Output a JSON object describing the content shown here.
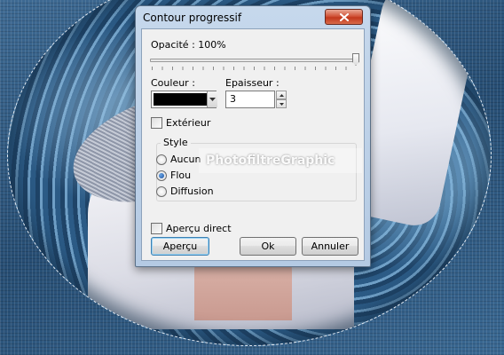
{
  "dialog": {
    "title": "Contour progressif",
    "close_icon": "close-icon",
    "opacity": {
      "label": "Opacité : 100%",
      "value_percent": 100
    },
    "color": {
      "label": "Couleur :",
      "value": "#000000",
      "dropdown_icon": "chevron-down-icon"
    },
    "thickness": {
      "label": "Epaisseur :",
      "value": "3"
    },
    "exterior": {
      "label": "Extérieur",
      "checked": false
    },
    "style": {
      "legend": "Style",
      "options": [
        {
          "label": "Aucun",
          "selected": false
        },
        {
          "label": "Flou",
          "selected": true
        },
        {
          "label": "Diffusion",
          "selected": false
        }
      ]
    },
    "live_preview": {
      "label": "Aperçu direct",
      "checked": false
    },
    "buttons": {
      "preview": "Aperçu",
      "ok": "Ok",
      "cancel": "Annuler"
    }
  },
  "watermark": "PhotofiltreGraphic",
  "colors": {
    "title_bar": "#b4cae3",
    "close_button": "#c2381c",
    "client_bg": "#f0f0f0",
    "radio_selected": "#1b4f9c"
  }
}
